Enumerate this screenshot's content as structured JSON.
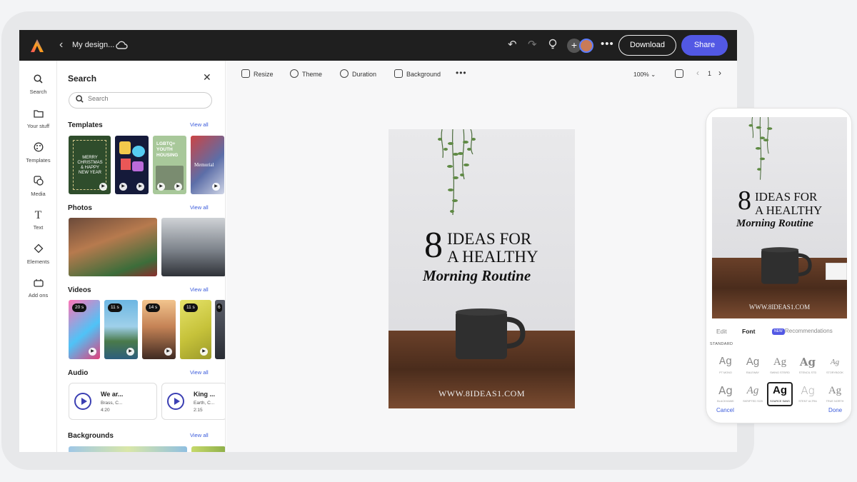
{
  "topbar": {
    "doc_name": "My design...",
    "download_label": "Download",
    "share_label": "Share",
    "accent": "#5258e4"
  },
  "rail": [
    {
      "label": "Search",
      "icon": "search-icon"
    },
    {
      "label": "Your stuff",
      "icon": "folder-icon"
    },
    {
      "label": "Templates",
      "icon": "palette-icon"
    },
    {
      "label": "Media",
      "icon": "media-icon"
    },
    {
      "label": "Text",
      "icon": "text-icon"
    },
    {
      "label": "Elements",
      "icon": "shapes-icon"
    },
    {
      "label": "Add ons",
      "icon": "add-ons-icon"
    }
  ],
  "panel": {
    "title": "Search",
    "search_placeholder": "Search",
    "view_all": "View all",
    "sections": {
      "templates": "Templates",
      "photos": "Photos",
      "videos": "Videos",
      "audio": "Audio",
      "backgrounds": "Backgrounds"
    },
    "template_captions": [
      "MERRY CHRISTMAS & HAPPY NEW YEAR",
      "",
      "LGBTQ+ YOUTH HOUSING",
      "Memorial"
    ],
    "video_durations": [
      "20 s",
      "11 s",
      "14 s",
      "11 s",
      "6"
    ],
    "audio": [
      {
        "title": "We ar...",
        "line1": "Brass, C...",
        "line2": "4:20"
      },
      {
        "title": "King ...",
        "line1": "Earth, C...",
        "line2": "2:15"
      }
    ]
  },
  "editor": {
    "tools": [
      "Resize",
      "Theme",
      "Duration",
      "Background"
    ],
    "zoom": "100%",
    "page_number": "1"
  },
  "design": {
    "number": "8",
    "line1": "IDEAS FOR",
    "line2": "A HEALTHY",
    "script": "Morning Routine",
    "url": "WWW.8IDEAS1.COM"
  },
  "phone": {
    "tabs": {
      "edit": "Edit",
      "font": "Font",
      "new_badge": "NEW",
      "recommendations": "Recommendations"
    },
    "standard_label": "STANDARD",
    "fonts": [
      "PT MONO",
      "RALEWAY",
      "SWING STEIRD",
      "STENCIL STD",
      "STORYBOOK",
      "BLACKHAWK",
      "SKRIPTED SCB",
      "SOURCE SANS",
      "STENT ULTRA",
      "TRUE NORTH"
    ],
    "sample": "Ag",
    "cancel": "Cancel",
    "done": "Done"
  }
}
